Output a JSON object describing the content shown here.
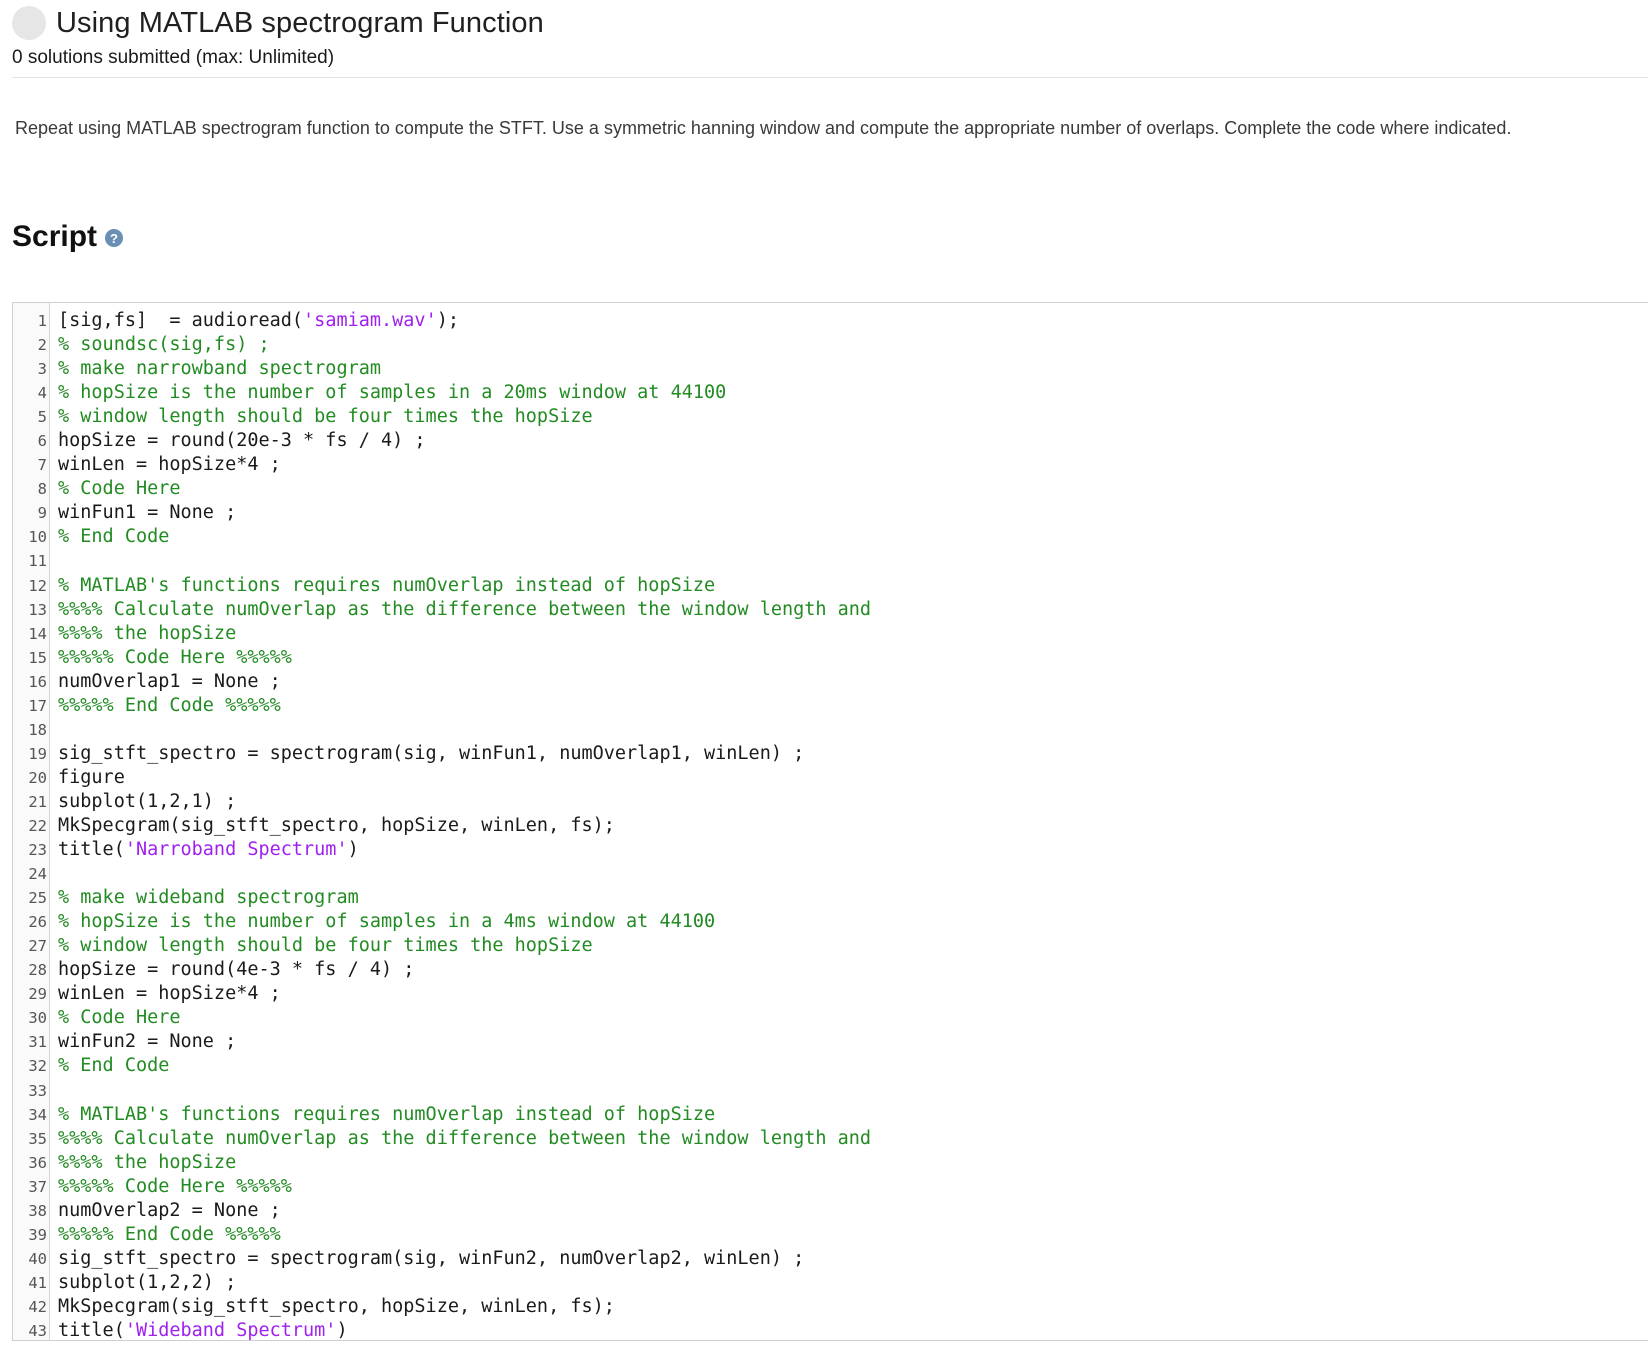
{
  "header": {
    "title": "Using MATLAB spectrogram Function",
    "submissions": "0 solutions submitted (max: Unlimited)"
  },
  "description": "Repeat using MATLAB spectrogram function to compute the STFT. Use a symmetric hanning window and compute the appropriate number of overlaps. Complete the code where indicated.",
  "script": {
    "heading": "Script",
    "help_icon_glyph": "?",
    "help_icon": "question-circle-icon",
    "colors": {
      "comment": "#228b22",
      "string": "#a020f0",
      "text": "#1a1a1a"
    },
    "lines": [
      [
        [
          "t",
          "[sig,fs]  = audioread("
        ],
        [
          "s",
          "'samiam.wav'"
        ],
        [
          "t",
          ");"
        ]
      ],
      [
        [
          "c",
          "% soundsc(sig,fs) ;"
        ]
      ],
      [
        [
          "c",
          "% make narrowband spectrogram"
        ]
      ],
      [
        [
          "c",
          "% hopSize is the number of samples in a 20ms window at 44100"
        ]
      ],
      [
        [
          "c",
          "% window length should be four times the hopSize"
        ]
      ],
      [
        [
          "t",
          "hopSize = round(20e-3 * fs / 4) ;"
        ]
      ],
      [
        [
          "t",
          "winLen = hopSize*4 ;"
        ]
      ],
      [
        [
          "c",
          "% Code Here"
        ]
      ],
      [
        [
          "t",
          "winFun1 = None ;"
        ]
      ],
      [
        [
          "c",
          "% End Code"
        ]
      ],
      [],
      [
        [
          "c",
          "% MATLAB's functions requires numOverlap instead of hopSize"
        ]
      ],
      [
        [
          "c",
          "%%%% Calculate numOverlap as the difference between the window length and"
        ]
      ],
      [
        [
          "c",
          "%%%% the hopSize"
        ]
      ],
      [
        [
          "c",
          "%%%%% Code Here %%%%%"
        ]
      ],
      [
        [
          "t",
          "numOverlap1 = None ;"
        ]
      ],
      [
        [
          "c",
          "%%%%% End Code %%%%%"
        ]
      ],
      [],
      [
        [
          "t",
          "sig_stft_spectro = spectrogram(sig, winFun1, numOverlap1, winLen) ;"
        ]
      ],
      [
        [
          "t",
          "figure"
        ]
      ],
      [
        [
          "t",
          "subplot(1,2,1) ;"
        ]
      ],
      [
        [
          "t",
          "MkSpecgram(sig_stft_spectro, hopSize, winLen, fs);"
        ]
      ],
      [
        [
          "t",
          "title("
        ],
        [
          "s",
          "'Narroband Spectrum'"
        ],
        [
          "t",
          ")"
        ]
      ],
      [],
      [
        [
          "c",
          "% make wideband spectrogram"
        ]
      ],
      [
        [
          "c",
          "% hopSize is the number of samples in a 4ms window at 44100"
        ]
      ],
      [
        [
          "c",
          "% window length should be four times the hopSize"
        ]
      ],
      [
        [
          "t",
          "hopSize = round(4e-3 * fs / 4) ;"
        ]
      ],
      [
        [
          "t",
          "winLen = hopSize*4 ;"
        ]
      ],
      [
        [
          "c",
          "% Code Here"
        ]
      ],
      [
        [
          "t",
          "winFun2 = None ;"
        ]
      ],
      [
        [
          "c",
          "% End Code"
        ]
      ],
      [],
      [
        [
          "c",
          "% MATLAB's functions requires numOverlap instead of hopSize"
        ]
      ],
      [
        [
          "c",
          "%%%% Calculate numOverlap as the difference between the window length and"
        ]
      ],
      [
        [
          "c",
          "%%%% the hopSize"
        ]
      ],
      [
        [
          "c",
          "%%%%% Code Here %%%%%"
        ]
      ],
      [
        [
          "t",
          "numOverlap2 = None ;"
        ]
      ],
      [
        [
          "c",
          "%%%%% End Code %%%%%"
        ]
      ],
      [
        [
          "t",
          "sig_stft_spectro = spectrogram(sig, winFun2, numOverlap2, winLen) ;"
        ]
      ],
      [
        [
          "t",
          "subplot(1,2,2) ;"
        ]
      ],
      [
        [
          "t",
          "MkSpecgram(sig_stft_spectro, hopSize, winLen, fs);"
        ]
      ],
      [
        [
          "t",
          "title("
        ],
        [
          "s",
          "'Wideband Spectrum'"
        ],
        [
          "t",
          ")"
        ]
      ]
    ]
  }
}
